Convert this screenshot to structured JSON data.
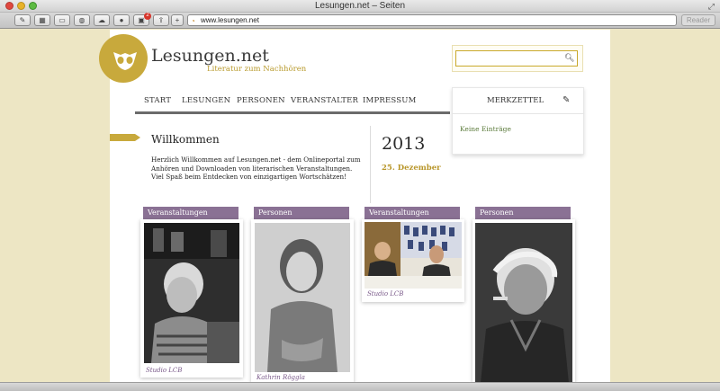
{
  "window": {
    "title": "Lesungen.net – Seiten"
  },
  "toolbar": {
    "address": "www.lesungen.net",
    "reader_label": "Reader",
    "badge_count": "2",
    "buttons": [
      "sidebar",
      "top-sites",
      "history",
      "icloud",
      "web",
      "notifications",
      "share",
      "new-tab"
    ]
  },
  "site": {
    "title": "Lesungen.net",
    "subtitle": "Literatur zum Nachhören",
    "accent_color": "#c8a93c",
    "label_color": "#8a7194"
  },
  "search": {
    "placeholder": ""
  },
  "nav": {
    "items": [
      "START",
      "LESUNGEN",
      "PERSONEN",
      "VERANSTALTER",
      "IMPRESSUM"
    ],
    "merkzettel": "MERKZETTEL",
    "merk_empty": "Keine Einträge"
  },
  "welcome": {
    "title": "Willkommen",
    "text": "Herzlich Willkommen auf Lesungen.net - dem Onlineportal zum Anhören und Downloaden von literarischen Veranstaltungen. Viel Spaß beim Entdecken von einzigartigen Wortschätzen!"
  },
  "calendar": {
    "year": "2013",
    "date": "25. Dezember"
  },
  "cards": [
    {
      "label": "Veranstaltungen",
      "caption": "Studio LCB"
    },
    {
      "label": "Personen",
      "caption": "Kathrin Röggla"
    },
    {
      "label": "Veranstaltungen",
      "caption": "Studio LCB"
    },
    {
      "label": "Personen",
      "caption": ""
    }
  ]
}
